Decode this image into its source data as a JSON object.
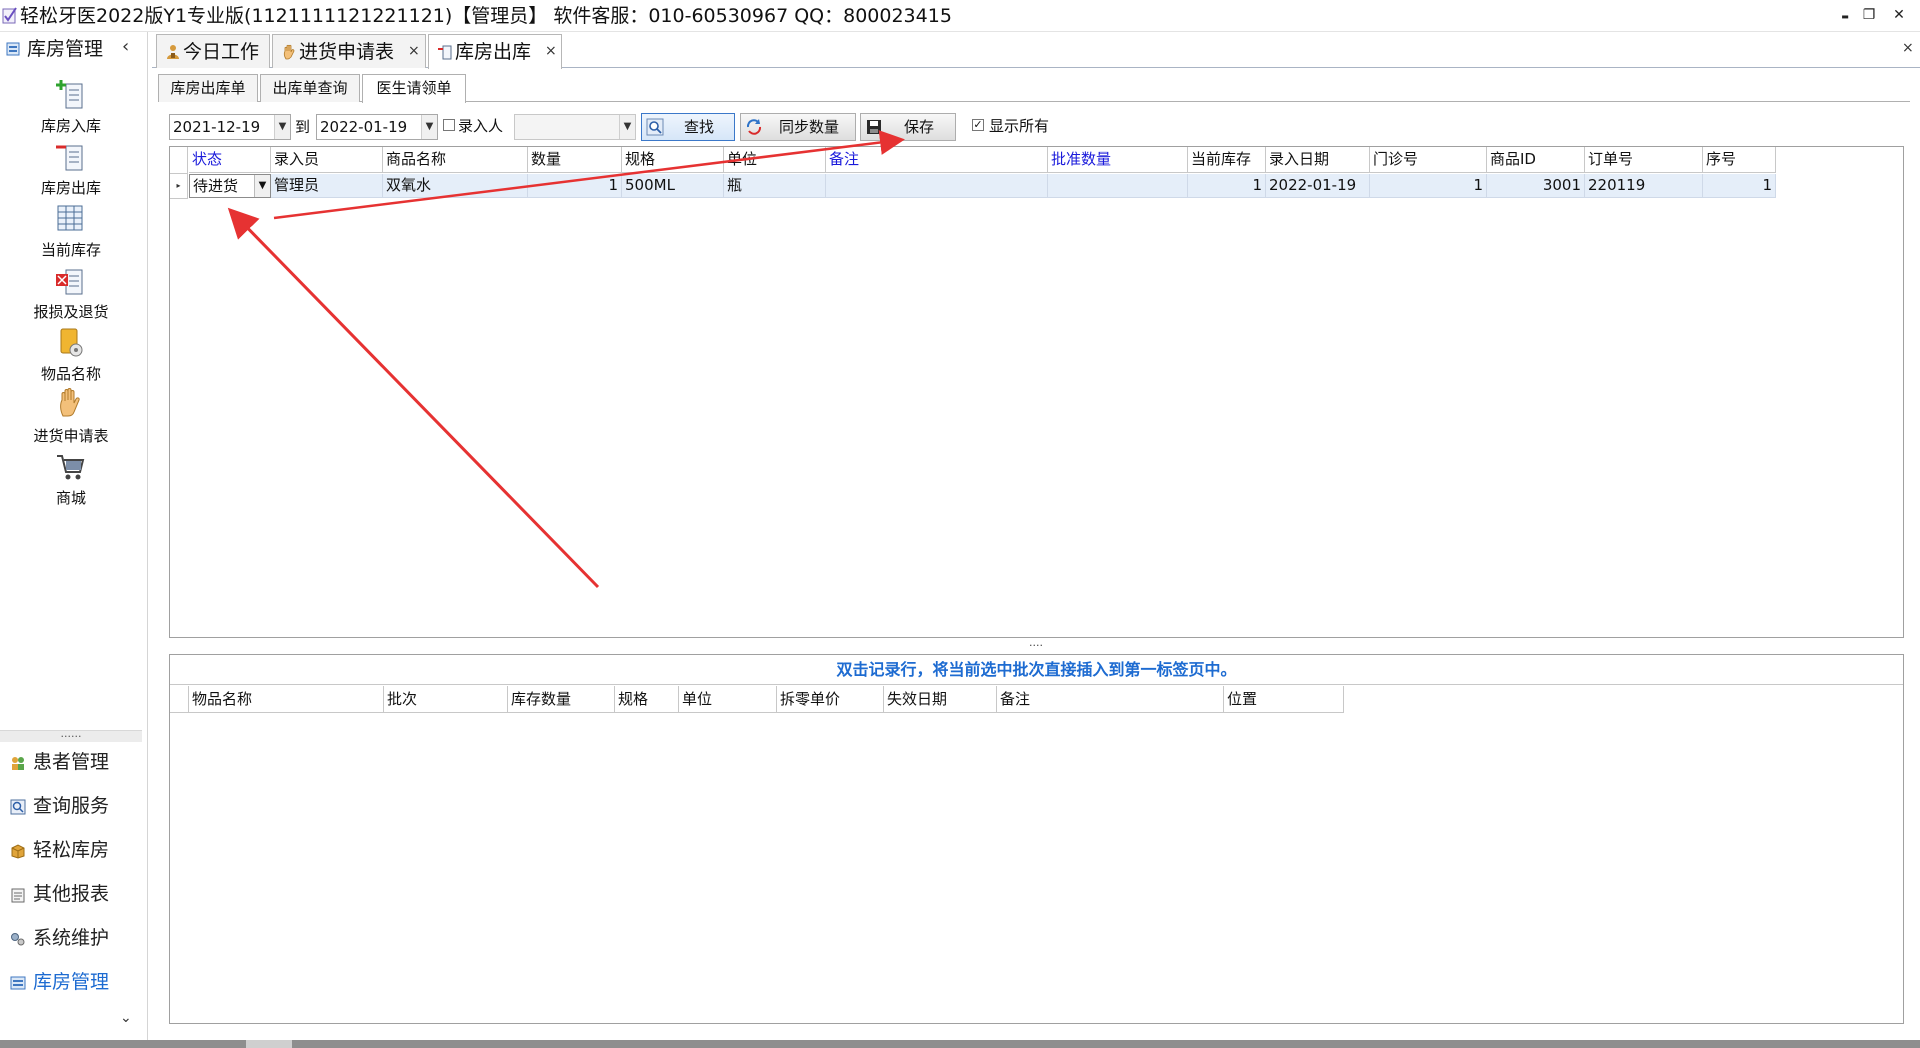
{
  "window": {
    "title": "轻松牙医2022版Y1专业版(1121111121221121)【管理员】   软件客服：010-60530967 QQ：800023415",
    "minimize_glyph": "▬",
    "restore_glyph": "❐",
    "close_glyph": "✕"
  },
  "sidebar": {
    "header": "库房管理",
    "collapse_glyph": "‹",
    "tools": [
      {
        "label": "库房入库",
        "icon": "stock-in-icon"
      },
      {
        "label": "库房出库",
        "icon": "stock-out-icon"
      },
      {
        "label": "当前库存",
        "icon": "inventory-grid-icon"
      },
      {
        "label": "报损及退货",
        "icon": "damage-return-icon"
      },
      {
        "label": "物品名称",
        "icon": "item-name-icon"
      },
      {
        "label": "进货申请表",
        "icon": "hand-request-icon"
      },
      {
        "label": "商城",
        "icon": "shopping-cart-icon"
      }
    ],
    "splitter_dots": "......",
    "modules": [
      {
        "label": "患者管理",
        "icon": "patients-icon"
      },
      {
        "label": "查询服务",
        "icon": "query-icon"
      },
      {
        "label": "轻松库房",
        "icon": "warehouse-icon"
      },
      {
        "label": "其他报表",
        "icon": "reports-icon"
      },
      {
        "label": "系统维护",
        "icon": "maintenance-icon"
      },
      {
        "label": "库房管理",
        "icon": "storage-icon",
        "active": true
      }
    ],
    "scroll_down_glyph": "⌄"
  },
  "doc_tabs": [
    {
      "label": "今日工作",
      "icon": "today-work-icon"
    },
    {
      "label": "进货申请表",
      "icon": "hand-request-icon",
      "closable": true
    },
    {
      "label": "库房出库",
      "icon": "stock-out-icon",
      "closable": true,
      "active": true
    }
  ],
  "close_glyph": "×",
  "sub_tabs": [
    {
      "label": "库房出库单"
    },
    {
      "label": "出库单查询"
    },
    {
      "label": "医生请领单",
      "active": true
    }
  ],
  "filter": {
    "date_from": "2021-12-19",
    "to_label": "到",
    "date_to": "2022-01-19",
    "entry_person_label": "录入人",
    "entry_person_value": "",
    "search_label": "查找",
    "sync_label": "同步数量",
    "save_label": "保存",
    "show_all_label": "显示所有",
    "show_all_checked": true,
    "check_glyph": "✓",
    "drop_glyph": "▼"
  },
  "upper_table": {
    "columns": [
      "状态",
      "录入员",
      "商品名称",
      "数量",
      "规格",
      "单位",
      "备注",
      "批准数量",
      "当前库存",
      "录入日期",
      "门诊号",
      "商品ID",
      "订单号",
      "序号"
    ],
    "rows": [
      {
        "状态": "待进货",
        "录入员": "管理员",
        "商品名称": "双氧水",
        "数量": "1",
        "规格": "500ML",
        "单位": "瓶",
        "备注": "",
        "批准数量": "",
        "当前库存": "1",
        "录入日期": "2022-01-19",
        "门诊号": "1",
        "商品ID": "3001",
        "订单号": "220119",
        "序号": "1"
      }
    ],
    "row_indicator": "▸"
  },
  "splitter_dots": "....",
  "lower_table": {
    "hint": "双击记录行，将当前选中批次直接插入到第一标签页中。",
    "columns": [
      "物品名称",
      "批次",
      "库存数量",
      "规格",
      "单位",
      "拆零单价",
      "失效日期",
      "备注",
      "位置"
    ]
  },
  "colors": {
    "accent": "#1d6bd1",
    "blue_header": "#1a1adb",
    "selected_row": "#e5eef9",
    "annotation_arrow": "#e63232"
  }
}
